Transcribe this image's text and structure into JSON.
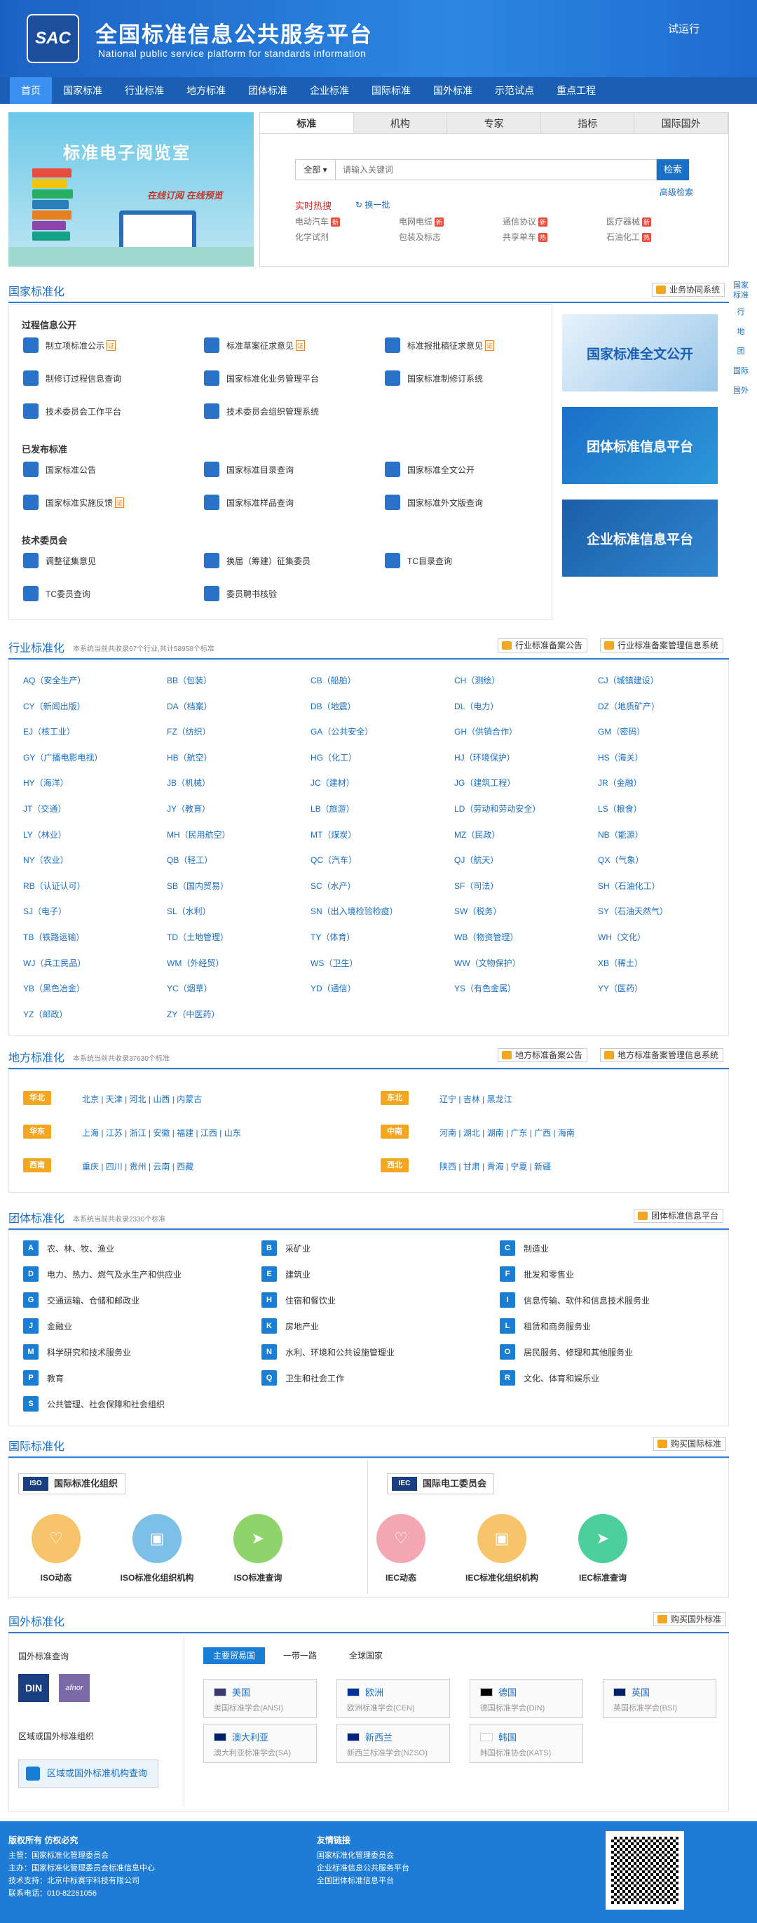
{
  "header": {
    "logo": "SAC",
    "title_cn": "全国标准信息公共服务平台",
    "title_en": "National public service platform  for standards information",
    "trial": "试运行"
  },
  "nav": [
    "首页",
    "国家标准",
    "行业标准",
    "地方标准",
    "团体标准",
    "企业标准",
    "国际标准",
    "国外标准",
    "示范试点",
    "重点工程"
  ],
  "banner": {
    "title": "标准电子阅览室",
    "slogan": "在线订阅 在线预览"
  },
  "search": {
    "tabs": [
      "标准",
      "机构",
      "专家",
      "指标",
      "国际国外"
    ],
    "select": "全部 ▾",
    "placeholder": "请输入关键词",
    "button": "检索",
    "advanced": "高级检索",
    "hot": "实时热搜",
    "refresh": "换一批",
    "keywords": [
      [
        "电动汽车",
        "新"
      ],
      [
        "电网电缆",
        "新"
      ],
      [
        "通信协议",
        "新"
      ],
      [
        "医疗器械",
        "新"
      ],
      [
        "化学试剂",
        ""
      ],
      [
        "包装及标志",
        ""
      ],
      [
        "共享单车",
        "热"
      ],
      [
        "石油化工",
        "热"
      ]
    ]
  },
  "national": {
    "title": "国家标准化",
    "btn": "业务协同系统",
    "groups": [
      {
        "name": "过程信息公开",
        "items": [
          [
            "制立项标准公示",
            "证"
          ],
          [
            "标准草案征求意见",
            "证"
          ],
          [
            "标准报批稿征求意见",
            "证"
          ],
          [
            "制修订过程信息查询",
            ""
          ],
          [
            "国家标准化业务管理平台",
            ""
          ],
          [
            "国家标准制修订系统",
            ""
          ],
          [
            "技术委员会工作平台",
            ""
          ],
          [
            "技术委员会组织管理系统",
            ""
          ]
        ]
      },
      {
        "name": "已发布标准",
        "items": [
          [
            "国家标准公告",
            ""
          ],
          [
            "国家标准目录查询",
            ""
          ],
          [
            "国家标准全文公开",
            ""
          ],
          [
            "国家标准实施反馈",
            "证"
          ],
          [
            "国家标准样品查询",
            ""
          ],
          [
            "国家标准外文版查询",
            ""
          ]
        ]
      },
      {
        "name": "技术委员会",
        "items": [
          [
            "调整征集意见",
            ""
          ],
          [
            "换届（筹建）征集委员",
            ""
          ],
          [
            "TC目录查询",
            ""
          ],
          [
            "TC委员查询",
            ""
          ],
          [
            "委员聘书核验",
            ""
          ]
        ]
      }
    ],
    "banners": [
      "国家标准全文公开",
      "团体标准信息平台",
      "企业标准信息平台"
    ]
  },
  "sidebar": [
    "国家标准",
    "行",
    "地",
    "团",
    "国际",
    "国外"
  ],
  "industry": {
    "title": "行业标准化",
    "note": "本系统当前共收录67个行业,共计58958个标准",
    "btn1": "行业标准备案公告",
    "btn2": "行业标准备案管理信息系统",
    "items": [
      "AQ（安全生产）",
      "BB（包装）",
      "CB（船舶）",
      "CH（测绘）",
      "CJ（城镇建设）",
      "CY（新闻出版）",
      "DA（档案）",
      "DB（地震）",
      "DL（电力）",
      "DZ（地质矿产）",
      "EJ（核工业）",
      "FZ（纺织）",
      "GA（公共安全）",
      "GH（供销合作）",
      "GM（密码）",
      "GY（广播电影电视）",
      "HB（航空）",
      "HG（化工）",
      "HJ（环境保护）",
      "HS（海关）",
      "HY（海洋）",
      "JB（机械）",
      "JC（建材）",
      "JG（建筑工程）",
      "JR（金融）",
      "JT（交通）",
      "JY（教育）",
      "LB（旅游）",
      "LD（劳动和劳动安全）",
      "LS（粮食）",
      "LY（林业）",
      "MH（民用航空）",
      "MT（煤炭）",
      "MZ（民政）",
      "NB（能源）",
      "NY（农业）",
      "QB（轻工）",
      "QC（汽车）",
      "QJ（航天）",
      "QX（气象）",
      "RB（认证认可）",
      "SB（国内贸易）",
      "SC（水产）",
      "SF（司法）",
      "SH（石油化工）",
      "SJ（电子）",
      "SL（水利）",
      "SN（出入境检验检疫）",
      "SW（税务）",
      "SY（石油天然气）",
      "TB（铁路运输）",
      "TD（土地管理）",
      "TY（体育）",
      "WB（物资管理）",
      "WH（文化）",
      "WJ（兵工民品）",
      "WM（外经贸）",
      "WS（卫生）",
      "WW（文物保护）",
      "XB（稀土）",
      "YB（黑色冶金）",
      "YC（烟草）",
      "YD（通信）",
      "YS（有色金属）",
      "YY（医药）",
      "YZ（邮政）",
      "ZY（中医药）"
    ]
  },
  "local": {
    "title": "地方标准化",
    "note": "本系统当前共收录37630个标准",
    "btn1": "地方标准备案公告",
    "btn2": "地方标准备案管理信息系统",
    "regions": [
      [
        "华北",
        "北京 | 天津 | 河北 | 山西 | 内蒙古"
      ],
      [
        "东北",
        "辽宁 | 吉林 | 黑龙江"
      ],
      [
        "华东",
        "上海 | 江苏 | 浙江 | 安徽 | 福建 | 江西 | 山东"
      ],
      [
        "中南",
        "河南 | 湖北 | 湖南 | 广东 | 广西 | 海南"
      ],
      [
        "西南",
        "重庆 | 四川 | 贵州 | 云南 | 西藏"
      ],
      [
        "西北",
        "陕西 | 甘肃 | 青海 | 宁夏 | 新疆"
      ]
    ]
  },
  "group": {
    "title": "团体标准化",
    "note": "本系统当前共收录2330个标准",
    "btn": "团体标准信息平台",
    "items": [
      [
        "A",
        "农、林、牧、渔业"
      ],
      [
        "B",
        "采矿业"
      ],
      [
        "C",
        "制造业"
      ],
      [
        "D",
        "电力、热力、燃气及水生产和供应业"
      ],
      [
        "E",
        "建筑业"
      ],
      [
        "F",
        "批发和零售业"
      ],
      [
        "G",
        "交通运输、仓储和邮政业"
      ],
      [
        "H",
        "住宿和餐饮业"
      ],
      [
        "I",
        "信息传输、软件和信息技术服务业"
      ],
      [
        "J",
        "金融业"
      ],
      [
        "K",
        "房地产业"
      ],
      [
        "L",
        "租赁和商务服务业"
      ],
      [
        "M",
        "科学研究和技术服务业"
      ],
      [
        "N",
        "水利、环境和公共设施管理业"
      ],
      [
        "O",
        "居民服务、修理和其他服务业"
      ],
      [
        "P",
        "教育"
      ],
      [
        "Q",
        "卫生和社会工作"
      ],
      [
        "R",
        "文化、体育和娱乐业"
      ],
      [
        "S",
        "公共管理、社会保障和社会组织"
      ]
    ]
  },
  "intl": {
    "title": "国际标准化",
    "btn": "购买国际标准",
    "iso": {
      "badge": "ISO",
      "name": "国际标准化组织",
      "items": [
        "ISO动态",
        "ISO标准化组织机构",
        "ISO标准查询"
      ]
    },
    "iec": {
      "badge": "IEC",
      "name": "国际电工委员会",
      "items": [
        "IEC动态",
        "IEC标准化组织机构",
        "IEC标准查询"
      ]
    },
    "colors": [
      "#f7c46b",
      "#7cc0e8",
      "#8fd36b",
      "#f2a7b3",
      "#f7c46b",
      "#4ccf9a"
    ]
  },
  "foreign": {
    "title": "国外标准化",
    "btn": "购买国外标准",
    "query": "国外标准查询",
    "logos": [
      "DIN",
      "afnor"
    ],
    "region_label": "区域或国外标准组织",
    "region_btn": "区域或国外标准机构查询",
    "tabs": [
      "主要贸易国",
      "一带一路",
      "全球国家"
    ],
    "cards": [
      [
        "美国",
        "美国标准学会(ANSI)"
      ],
      [
        "欧洲",
        "欧洲标准学会(CEN)"
      ],
      [
        "德国",
        "德国标准学会(DIN)"
      ],
      [
        "英国",
        "英国标准学会(BSI)"
      ],
      [
        "澳大利亚",
        "澳大利亚标准学会(SA)"
      ],
      [
        "新西兰",
        "新西兰标准学会(NZSO)"
      ],
      [
        "韩国",
        "韩国标准协会(KATS)"
      ]
    ]
  },
  "footer": {
    "copyright": "版权所有 仿权必究",
    "lines": [
      "主管：国家标准化管理委员会",
      "主办：国家标准化管理委员会标准信息中心",
      "技术支持：北京中标赛宇科技有限公司",
      "联系电话：010-82261056"
    ],
    "links_title": "友情链接",
    "links": [
      "国家标准化管理委员会",
      "企业标准信息公共服务平台",
      "全国团体标准信息平台"
    ]
  }
}
